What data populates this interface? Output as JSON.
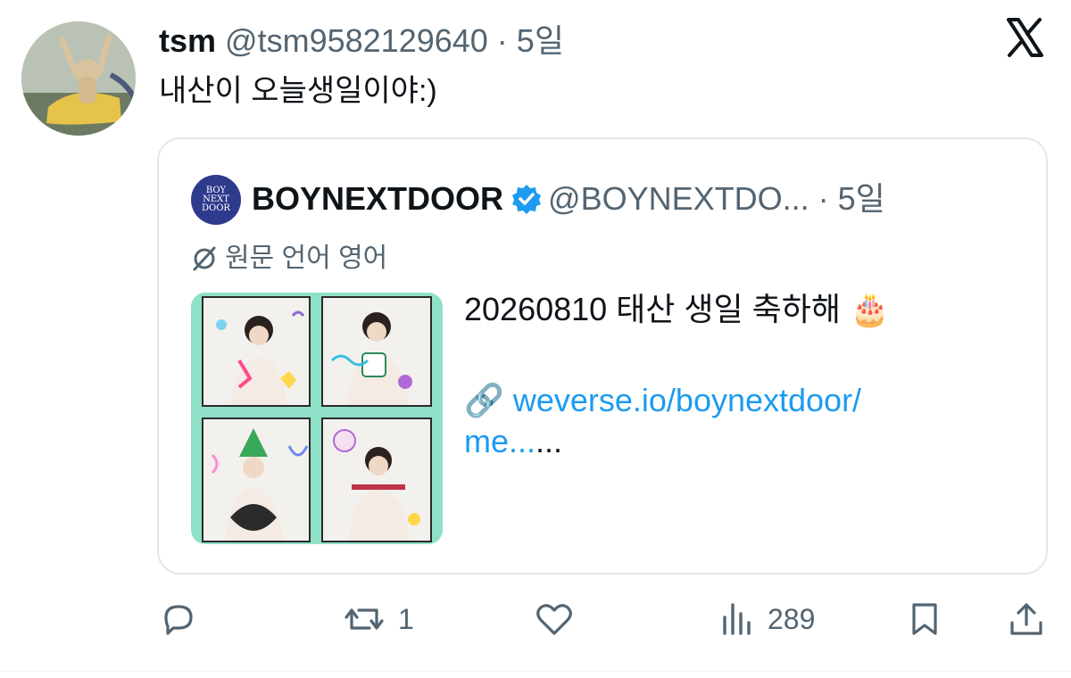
{
  "tweet": {
    "display_name": "tsm",
    "handle": "@tsm95821296​40",
    "separator": " · ",
    "time": "5일",
    "text": "내산이 오늘생일이야:)"
  },
  "quote": {
    "display_name": "BOYNEXTDOOR",
    "handle": "@BOYNEXTDO...",
    "separator": " · ",
    "time": "5일",
    "translation_note": "원문 언어 영어",
    "avatar_text": "BOY NEXT DOOR",
    "text_line1": "20260810 태산 생일 축하해",
    "cake_emoji": "🎂",
    "link_emoji": "🔗",
    "link_text": "weverse.io/boynextdoor/",
    "link_text2": "me...",
    "ellipsis": "..."
  },
  "actions": {
    "reply_count": "",
    "retweet_count": "1",
    "like_count": "",
    "views_count": "289"
  },
  "colors": {
    "text_primary": "#0f1419",
    "text_secondary": "#536471",
    "link": "#1d9bf0",
    "verified": "#1d9bf0",
    "border": "#e3e7ea"
  },
  "icons": [
    "x-logo-icon",
    "verified-badge-icon",
    "translate-icon",
    "reply-icon",
    "retweet-icon",
    "like-icon",
    "views-icon",
    "bookmark-icon",
    "share-icon"
  ]
}
